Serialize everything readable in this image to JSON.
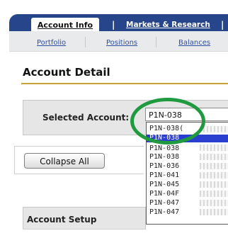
{
  "nav": {
    "tabs": [
      {
        "label": "Account Info"
      },
      {
        "label": "Markets & Research"
      }
    ],
    "separator": "|",
    "sub_links": [
      "Portfolio",
      "Positions",
      "Balances"
    ]
  },
  "page": {
    "title": "Account Detail"
  },
  "account_selector": {
    "label": "Selected Account:",
    "selected_value": "P1N-038",
    "options": [
      "P1N-038(",
      "P1N-038",
      "P1N-038",
      "P1N-038",
      "P1N-036",
      "P1N-041",
      "P1N-045",
      "P1N-04F",
      "P1N-047"
    ],
    "highlighted_index": 1
  },
  "collapse_button": {
    "label": "Collapse All"
  },
  "sections": {
    "account_setup": "Account Setup"
  },
  "colors": {
    "nav_bar": "#26458a",
    "title_rule": "#c9a13b",
    "highlight_circle": "#1f9a3e",
    "selected_option": "#2a3fcf"
  }
}
